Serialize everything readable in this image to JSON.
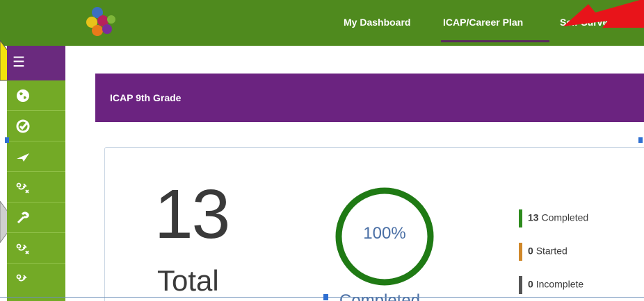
{
  "header": {
    "nav": [
      {
        "label": "My Dashboard"
      },
      {
        "label": "ICAP/Career Plan"
      },
      {
        "label": "Self-Surveys"
      }
    ],
    "colors": {
      "bar": "#4f8a1e",
      "active_underline": "#5a2a5e"
    }
  },
  "sidebar": {
    "menu_icon": "hamburger-icon",
    "items": [
      {
        "icon": "globe-icon"
      },
      {
        "icon": "check-badge-icon"
      },
      {
        "icon": "paper-plane-icon"
      },
      {
        "icon": "strategy-icon"
      },
      {
        "icon": "wrench-icon"
      },
      {
        "icon": "strategy-icon"
      },
      {
        "icon": "strategy-icon"
      }
    ]
  },
  "panel": {
    "title": "ICAP 9th Grade"
  },
  "summary": {
    "total": "13",
    "total_label": "Total",
    "percent": "100%",
    "percent_value": 1.0,
    "completed_label": "Completed",
    "stats": [
      {
        "count": "13",
        "label": "Completed",
        "color": "#2e8b1e"
      },
      {
        "count": "0",
        "label": "Started",
        "color": "#d0882a"
      },
      {
        "count": "0",
        "label": "Incomplete",
        "color": "#555555"
      }
    ]
  }
}
